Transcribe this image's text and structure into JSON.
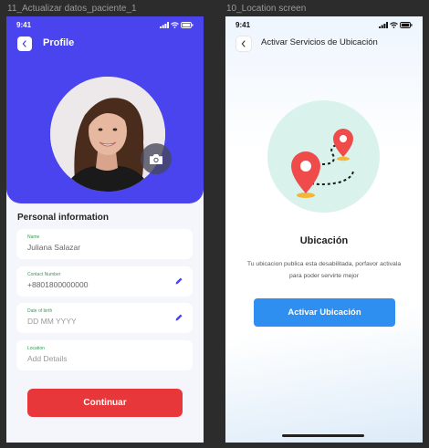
{
  "frames": {
    "left_label": "11_Actualizar datos_paciente_1",
    "right_label": "10_Location screen"
  },
  "profile_screen": {
    "status_time": "9:41",
    "title": "Profile",
    "section_title": "Personal information",
    "fields": [
      {
        "label": "Name",
        "value": "Juliana Salazar",
        "editable": false,
        "placeholder": false
      },
      {
        "label": "Contact Number",
        "value": "+8801800000000",
        "editable": true,
        "placeholder": false
      },
      {
        "label": "Date of birth",
        "value": "DD MM YYYY",
        "editable": true,
        "placeholder": true
      },
      {
        "label": "Location",
        "value": "Add Details",
        "editable": false,
        "placeholder": true
      }
    ],
    "continue_label": "Continuar"
  },
  "location_screen": {
    "status_time": "9:41",
    "title": "Activar Servicios de Ubicación",
    "heading": "Ubicación",
    "description": "Tu ubicacion publica esta desabilitada, porfavor activala para poder servirte mejor",
    "activate_label": "Activar Ubicación"
  },
  "colors": {
    "primary_purple": "#4a44ee",
    "continue_red": "#e7373a",
    "activate_blue": "#2f8ff0",
    "field_label_green": "#3a9a55",
    "pin_red": "#ef4b4b",
    "illustration_bg": "#d9f3ec"
  },
  "icons": [
    "back-chevron-icon",
    "camera-icon",
    "pencil-icon",
    "map-pin-icon",
    "signal-icon",
    "wifi-icon",
    "battery-icon"
  ]
}
